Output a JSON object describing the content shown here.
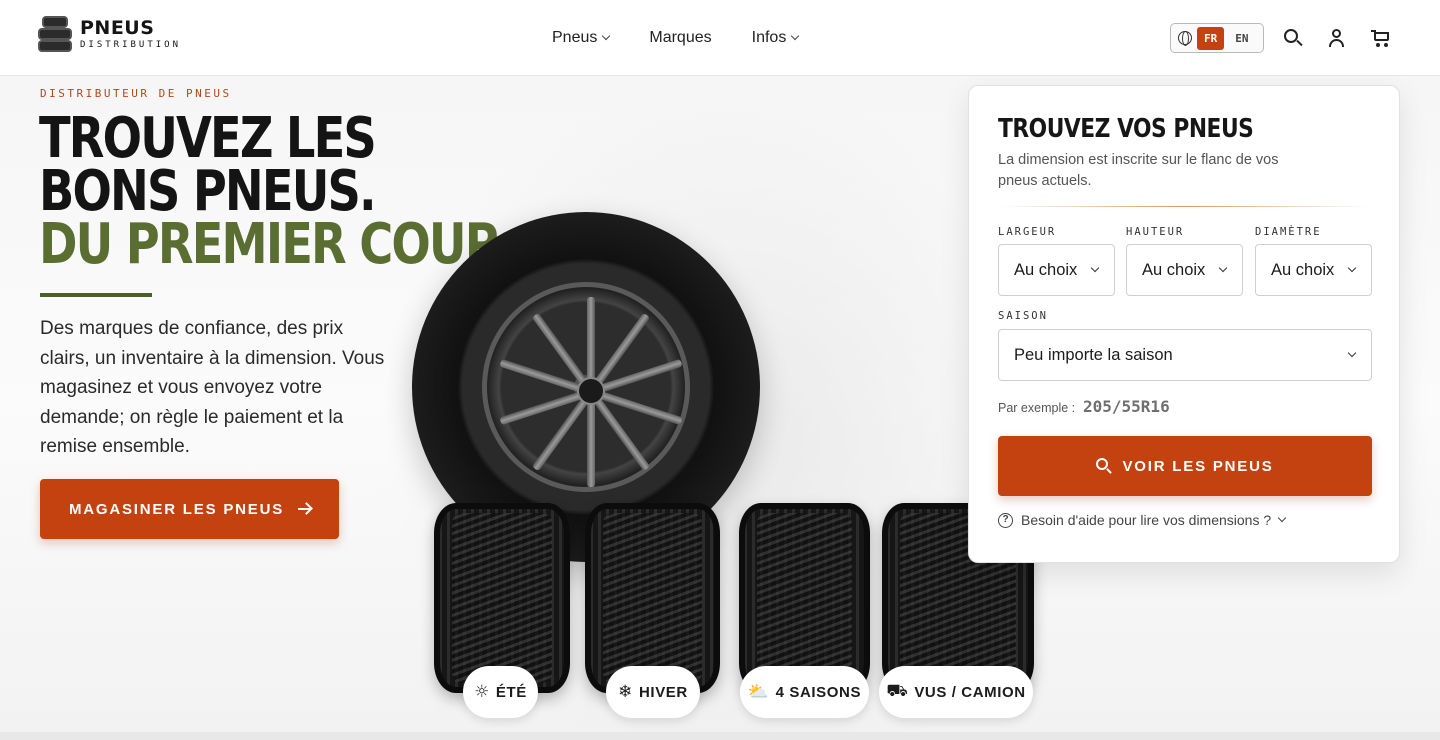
{
  "brand": {
    "title": "PNEUS",
    "subtitle": "DISTRIBUTION"
  },
  "nav": {
    "items": [
      {
        "label": "Pneus",
        "has_dropdown": true
      },
      {
        "label": "Marques",
        "has_dropdown": false
      },
      {
        "label": "Infos",
        "has_dropdown": true
      }
    ]
  },
  "lang": {
    "active": "FR",
    "other": "EN",
    "icon": "globe-icon"
  },
  "header_icons": [
    "search-icon",
    "user-icon",
    "cart-icon"
  ],
  "hero": {
    "eyebrow": "DISTRIBUTEUR DE PNEUS",
    "headline": [
      "TROUVEZ LES",
      "BONS PNEUS.",
      "DU PREMIER COUP."
    ],
    "lead": "Des marques de confiance, des prix clairs, un inventaire à la dimension. Vous magasinez et vous envoyez votre demande; on règle le paiement et la remise ensemble.",
    "cta": "MAGASINER LES PNEUS"
  },
  "categories": [
    {
      "label": "ÉTÉ",
      "icon": "sun-icon"
    },
    {
      "label": "HIVER",
      "icon": "snowflake-icon"
    },
    {
      "label": "4 SAISONS",
      "icon": "sun-cloud-icon"
    },
    {
      "label": "VUS / CAMION",
      "icon": "truck-icon"
    }
  ],
  "finder": {
    "title": "TROUVEZ VOS PNEUS",
    "subtitle": "La dimension est inscrite sur le flanc de vos pneus actuels.",
    "fields": {
      "largeur": {
        "label": "LARGEUR",
        "value": "Au choix"
      },
      "hauteur": {
        "label": "HAUTEUR",
        "value": "Au choix"
      },
      "diametre": {
        "label": "DIAMÈTRE",
        "value": "Au choix"
      },
      "saison": {
        "label": "SAISON",
        "value": "Peu importe la saison"
      }
    },
    "example_label": "Par exemple :",
    "example_value": "205/55R16",
    "button": "VOIR LES PNEUS",
    "help": "Besoin d'aide pour lire vos dimensions ?"
  },
  "colors": {
    "accent": "#c4420f",
    "olive": "#5b6e32",
    "eyebrow": "#b4481a"
  }
}
